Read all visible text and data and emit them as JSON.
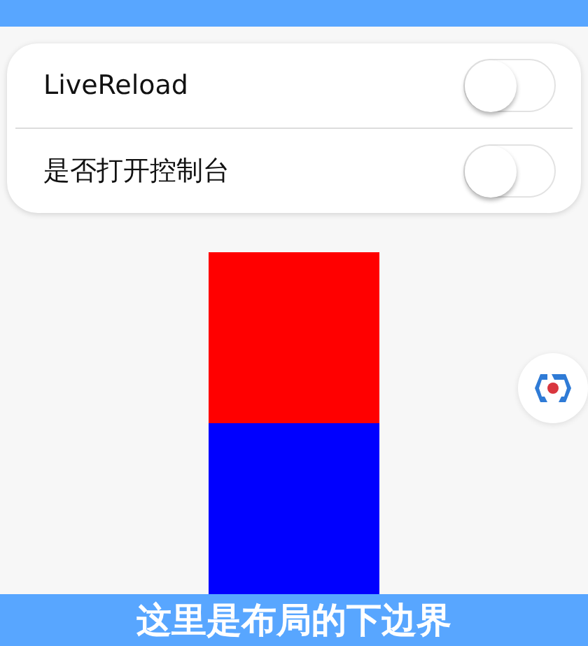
{
  "settings": [
    {
      "label": "LiveReload",
      "on": false
    },
    {
      "label": "是否打开控制台",
      "on": false
    }
  ],
  "blocks": [
    {
      "color": "#ff0000"
    },
    {
      "color": "#0000ff"
    }
  ],
  "footer": {
    "text": "这里是布局的下边界"
  }
}
